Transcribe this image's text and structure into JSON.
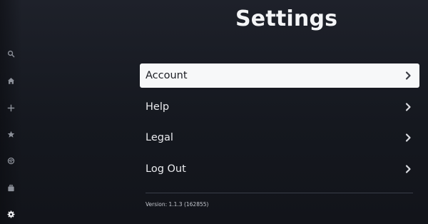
{
  "header": {
    "title": "Settings"
  },
  "sidebar": {
    "items": [
      {
        "icon": "search-icon"
      },
      {
        "icon": "home-icon"
      },
      {
        "icon": "plus-icon"
      },
      {
        "icon": "star-icon"
      },
      {
        "icon": "originals-icon"
      },
      {
        "icon": "movies-icon"
      },
      {
        "icon": "gear-icon",
        "active": true
      }
    ]
  },
  "menu": {
    "items": [
      {
        "label": "Account",
        "selected": true
      },
      {
        "label": "Help"
      },
      {
        "label": "Legal"
      },
      {
        "label": "Log Out"
      }
    ]
  },
  "footer": {
    "version": "Version: 1.1.3 (162855)"
  },
  "colors": {
    "background": "#191c24",
    "selected_background": "#f7f8f9",
    "text": "#e9eaed",
    "icon_dim": "#8c9099",
    "icon_active": "#f4f5f7"
  }
}
